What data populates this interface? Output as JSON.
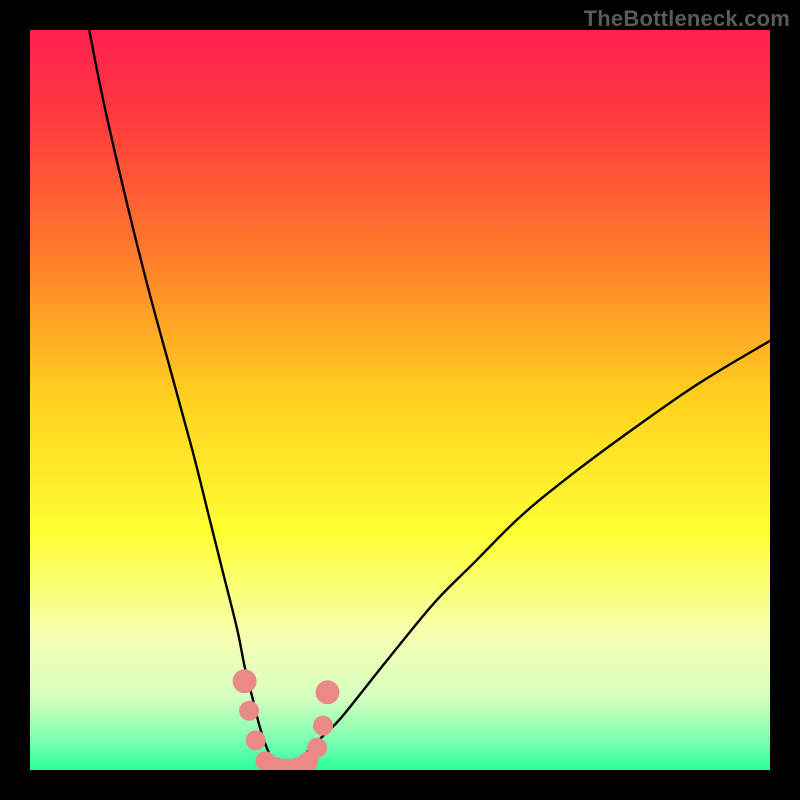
{
  "watermark": "TheBottleneck.com",
  "chart_data": {
    "type": "line",
    "title": "",
    "xlabel": "",
    "ylabel": "",
    "xlim": [
      0,
      100
    ],
    "ylim": [
      0,
      100
    ],
    "grid": false,
    "legend": false,
    "axes_visible": false,
    "background_gradient": {
      "type": "vertical",
      "stops": [
        {
          "pos": 0.0,
          "color": "#ff1f4f"
        },
        {
          "pos": 0.12,
          "color": "#ff3a3f"
        },
        {
          "pos": 0.3,
          "color": "#ff7a2a"
        },
        {
          "pos": 0.5,
          "color": "#ffd21f"
        },
        {
          "pos": 0.68,
          "color": "#ffff33"
        },
        {
          "pos": 0.82,
          "color": "#f6ffb3"
        },
        {
          "pos": 0.9,
          "color": "#d8ffc0"
        },
        {
          "pos": 0.96,
          "color": "#7dffb0"
        },
        {
          "pos": 1.0,
          "color": "#29ff9d"
        }
      ]
    },
    "series": [
      {
        "name": "bottleneck-curve",
        "note": "V-shaped curve; y is bottleneck metric (0 at optimum ~x=34, rising to ~100 at x=8 and ~58 at x=100).",
        "x": [
          8,
          10,
          13,
          16,
          19,
          22,
          24,
          26,
          28,
          29,
          30,
          31,
          32,
          33,
          34,
          35,
          36,
          37,
          38,
          39,
          40,
          42,
          46,
          50,
          55,
          60,
          66,
          72,
          80,
          90,
          100
        ],
        "y": [
          100,
          90,
          77,
          65,
          54,
          43,
          35,
          27,
          19,
          14,
          10,
          6,
          3,
          1,
          0,
          0,
          1,
          2,
          3,
          4,
          5,
          7,
          12,
          17,
          23,
          28,
          34,
          39,
          45,
          52,
          58
        ]
      }
    ],
    "markers": {
      "name": "highlight-dots",
      "color": "#e98a86",
      "radius_main": 10,
      "radius_end": 12,
      "note": "Salmon dots along the bottom of the V plus the two ends of the flat segment.",
      "points": [
        {
          "x": 29.0,
          "y": 12.0
        },
        {
          "x": 29.6,
          "y": 8.0
        },
        {
          "x": 30.5,
          "y": 4.0
        },
        {
          "x": 31.8,
          "y": 1.2
        },
        {
          "x": 33.2,
          "y": 0.4
        },
        {
          "x": 34.8,
          "y": 0.2
        },
        {
          "x": 36.2,
          "y": 0.4
        },
        {
          "x": 37.6,
          "y": 1.2
        },
        {
          "x": 38.8,
          "y": 3.0
        },
        {
          "x": 39.6,
          "y": 6.0
        },
        {
          "x": 40.2,
          "y": 10.5
        }
      ]
    }
  }
}
